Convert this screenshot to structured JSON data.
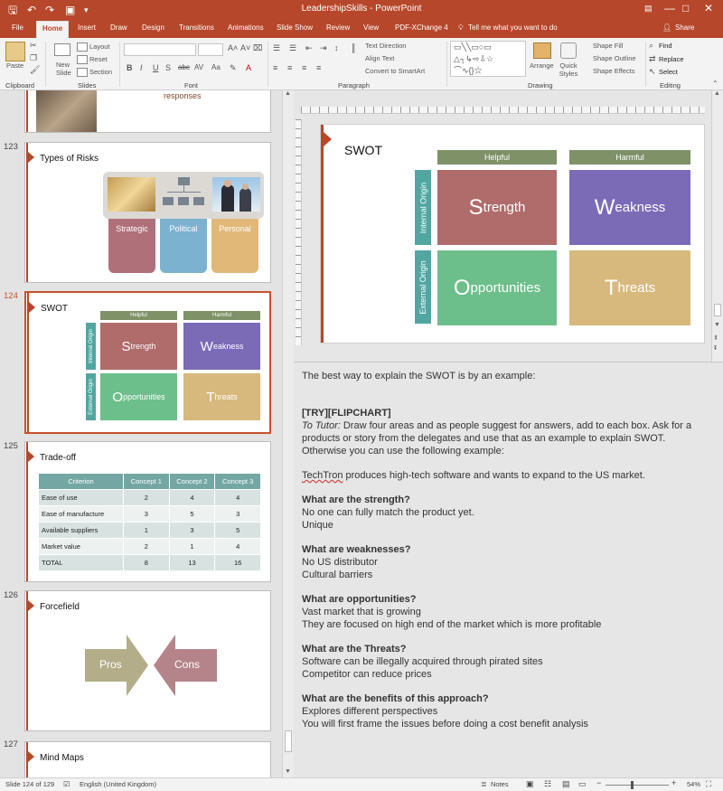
{
  "window": {
    "title": "LeadershipSkills - PowerPoint",
    "controls": [
      "—",
      "□",
      "✕"
    ]
  },
  "ribbon_tabs": [
    "File",
    "Home",
    "Insert",
    "Draw",
    "Design",
    "Transitions",
    "Animations",
    "Slide Show",
    "Review",
    "View",
    "PDF-XChange 4"
  ],
  "active_tab": "Home",
  "tell_me": "Tell me what you want to do",
  "share": "Share",
  "ribbon": {
    "clipboard": {
      "paste": "Paste",
      "label": "Clipboard"
    },
    "slides": {
      "new_slide": "New Slide",
      "layout": "Layout",
      "reset": "Reset",
      "section": "Section",
      "label": "Slides"
    },
    "font": {
      "bold": "B",
      "italic": "I",
      "underline": "U",
      "shadow": "S",
      "strike": "abc",
      "spacing": "AV",
      "case": "Aa",
      "label": "Font"
    },
    "paragraph": {
      "text_direction": "Text Direction",
      "align_text": "Align Text",
      "convert": "Convert to SmartArt",
      "label": "Paragraph"
    },
    "drawing": {
      "arrange": "Arrange",
      "quick_styles": "Quick Styles",
      "shape_fill": "Shape Fill",
      "shape_outline": "Shape Outline",
      "shape_effects": "Shape Effects",
      "label": "Drawing"
    },
    "editing": {
      "find": "Find",
      "replace": "Replace",
      "select": "Select",
      "label": "Editing"
    }
  },
  "thumbnails": {
    "s122": {
      "partial_text": "responses"
    },
    "s123": {
      "num": "123",
      "title": "Types of Risks",
      "cards": [
        "Strategic",
        "Political",
        "Personal"
      ]
    },
    "s124": {
      "num": "124",
      "title": "SWOT",
      "helpful": "Helpful",
      "harmful": "Harmful",
      "internal": "Internal Origin",
      "external": "External Origin"
    },
    "s125": {
      "num": "125",
      "title": "Trade-off",
      "headers": [
        "Criterion",
        "Concept 1",
        "Concept 2",
        "Concept 3"
      ],
      "rows": [
        [
          "Ease of use",
          "2",
          "4",
          "4"
        ],
        [
          "Ease of manufacture",
          "3",
          "5",
          "3"
        ],
        [
          "Available suppliers",
          "1",
          "3",
          "5"
        ],
        [
          "Market value",
          "2",
          "1",
          "4"
        ],
        [
          "TOTAL",
          "8",
          "13",
          "16"
        ]
      ]
    },
    "s126": {
      "num": "126",
      "title": "Forcefield",
      "pros": "Pros",
      "cons": "Cons"
    },
    "s127": {
      "num": "127",
      "title": "Mind Maps"
    }
  },
  "main_slide": {
    "title": "SWOT",
    "helpful": "Helpful",
    "harmful": "Harmful",
    "internal": "Internal Origin",
    "external": "External Origin",
    "quadrants": [
      {
        "initial": "S",
        "rest": "trength"
      },
      {
        "initial": "W",
        "rest": "eakness"
      },
      {
        "initial": "O",
        "rest": "pportunities"
      },
      {
        "initial": "T",
        "rest": "hreats"
      }
    ]
  },
  "notes": {
    "intro": "The best way to explain the SWOT is by an example:",
    "tag": "[TRY][FLIPCHART]",
    "tutor_prefix": "To Tutor:",
    "tutor_line1": " Draw four areas and as people suggest for answers, add to each box. Ask for a",
    "tutor_line2": "products or story from the delegates and use that as an example to explain SWOT.",
    "tutor_line3": "Otherwise you can use the following example:",
    "example_name": "TechTron",
    "example_rest": " produces high-tech software and wants to expand to the US market.",
    "q1": "What are the strength?",
    "a1": [
      "No one can fully match the product yet.",
      "Unique"
    ],
    "q2": "What are weaknesses?",
    "a2": [
      "No US distributor",
      "Cultural barriers"
    ],
    "q3": "What are opportunities?",
    "a3": [
      "Vast market that is growing",
      "They are focused on high end of the market which is more profitable"
    ],
    "q4": "What are the Threats?",
    "a4": [
      "Software can be illegally acquired through pirated sites",
      "Competitor can reduce prices"
    ],
    "q5": "What are the benefits of this approach?",
    "a5": [
      "Explores different perspectives",
      "You will first frame the issues before doing a cost benefit analysis"
    ]
  },
  "status": {
    "slide": "Slide 124 of 129",
    "language": "English (United Kingdom)",
    "notes": "Notes",
    "zoom": "54%"
  },
  "colors": {
    "accent": "#b7472a",
    "strength": "#b06b6b",
    "weakness": "#7b6bb7",
    "opportunities": "#6cbf8a",
    "threats": "#d7b97d",
    "header_green": "#7e9167",
    "side_teal": "#51a6a1"
  }
}
